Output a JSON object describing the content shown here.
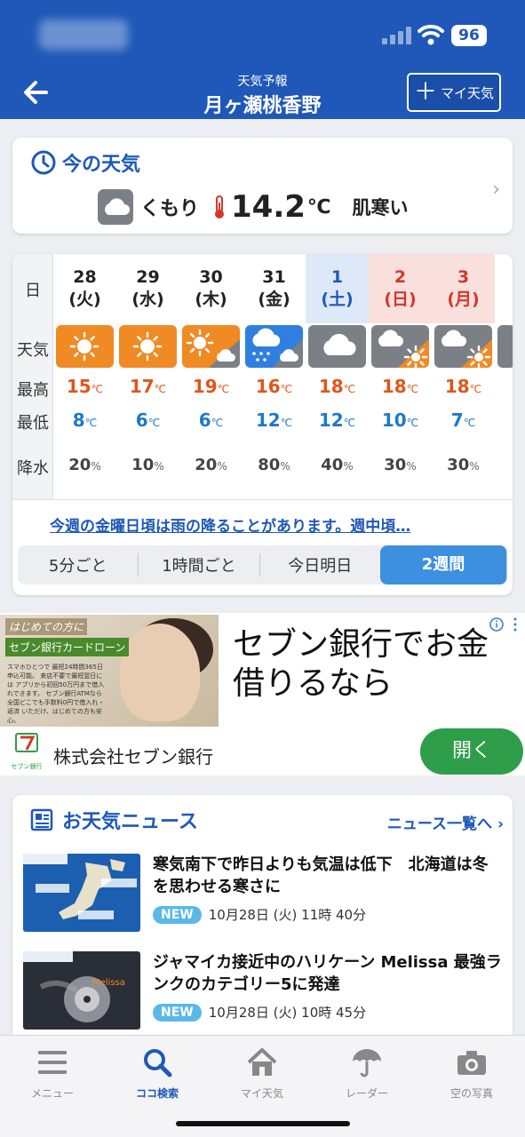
{
  "header": {
    "subtitle": "天気予報",
    "title": "月ヶ瀬桃香野",
    "battery": "96",
    "my_weather_btn": "マイ天気",
    "my_weather_plus": "＋"
  },
  "now": {
    "section_title": "今の天気",
    "condition": "くもり",
    "temp": "14.2",
    "unit": "℃",
    "feel": "肌寒い"
  },
  "forecast": {
    "labels": {
      "day": "日",
      "weather": "天気",
      "high": "最高",
      "low": "最低",
      "rain": "降水"
    },
    "temp_unit": "℃",
    "rain_unit": "%",
    "days": [
      {
        "date": "28",
        "dow": "(火)",
        "type": "weekday",
        "icon": "sun-icon",
        "hi": "15",
        "lo": "8",
        "rain": "20"
      },
      {
        "date": "29",
        "dow": "(水)",
        "type": "weekday",
        "icon": "sun-icon",
        "hi": "17",
        "lo": "6",
        "rain": "10"
      },
      {
        "date": "30",
        "dow": "(木)",
        "type": "weekday",
        "icon": "sun-then-cloud-icon",
        "hi": "19",
        "lo": "6",
        "rain": "20"
      },
      {
        "date": "31",
        "dow": "(金)",
        "type": "weekday",
        "icon": "rain-then-cloud-icon",
        "hi": "16",
        "lo": "12",
        "rain": "80"
      },
      {
        "date": "1",
        "dow": "(土)",
        "type": "sat",
        "icon": "cloud-icon",
        "hi": "18",
        "lo": "12",
        "rain": "40"
      },
      {
        "date": "2",
        "dow": "(日)",
        "type": "sun",
        "icon": "cloud-then-sun-icon",
        "hi": "18",
        "lo": "10",
        "rain": "30"
      },
      {
        "date": "3",
        "dow": "(月)",
        "type": "sun",
        "icon": "cloud-then-sun-icon",
        "hi": "18",
        "lo": "7",
        "rain": "30"
      }
    ],
    "week_link": "今週の金曜日頃は雨の降ることがあります。週中頃…",
    "segments": [
      "5分ごと",
      "1時間ごと",
      "今日明日",
      "2週間"
    ],
    "active_segment": "2週間"
  },
  "ad": {
    "banner1": "はじめての方に",
    "banner2": "セブン銀行カードローン",
    "small_text": "スマホひとつで 最短24時間365日申込可能。 来店不要で最短翌日には アプリから初回50万円まで借入れできます。 セブン銀行ATMなら 全国どこでも手数料0円で借入れ・返済 いただけ、はじめての方も安心。",
    "headline": "セブン銀行でお金借りるなら",
    "company": "株式会社セブン銀行",
    "logo_text": "セブン銀行",
    "open_btn": "開く"
  },
  "news": {
    "section_title": "お天気ニュース",
    "more_link": "ニュース一覧へ",
    "items": [
      {
        "title": "寒気南下で昨日よりも気温は低下　北海道は冬を思わせる寒さに",
        "badge": "NEW",
        "time": "10月28日 (火) 11時 40分",
        "thumb": "weather-map-thumb"
      },
      {
        "title": "ジャマイカ接近中のハリケーン Melissa 最強ランクのカテゴリー5に発達",
        "badge": "NEW",
        "time": "10月28日 (火) 10時 45分",
        "thumb": "hurricane-satellite-thumb"
      }
    ]
  },
  "tabs": [
    {
      "label": "メニュー",
      "icon": "menu-icon"
    },
    {
      "label": "ココ検索",
      "icon": "search-icon",
      "active": true
    },
    {
      "label": "マイ天気",
      "icon": "home-icon"
    },
    {
      "label": "レーダー",
      "icon": "umbrella-icon"
    },
    {
      "label": "空の写真",
      "icon": "camera-icon"
    }
  ],
  "colors": {
    "brand": "#1f58b8",
    "high": "#e0561a",
    "low": "#1f78c8",
    "sunny": "#f08a24",
    "cloudy": "#7b7f86",
    "rainy": "#2f7fe0",
    "accent_button": "#3d8fe0",
    "ad_button": "#2e9e4a"
  }
}
